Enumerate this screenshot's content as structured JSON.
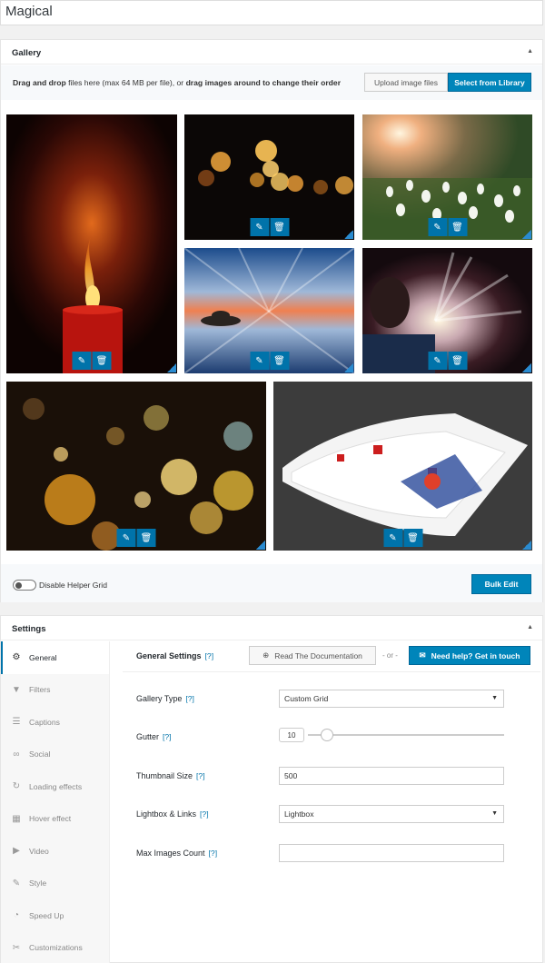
{
  "title": "Magical",
  "gallery": {
    "header": "Gallery",
    "upload": {
      "text_bold1": "Drag and drop",
      "text_mid": " files here (max 64 MB per file), or ",
      "text_bold2": "drag images around to change their order",
      "upload_btn": "Upload image files",
      "library_btn": "Select from Library"
    },
    "images": [
      {
        "name": "candle-flame"
      },
      {
        "name": "bokeh-lights-dark"
      },
      {
        "name": "snowdrop-flowers"
      },
      {
        "name": "island-sunset-reflection"
      },
      {
        "name": "glowing-book"
      },
      {
        "name": "golden-bokeh"
      },
      {
        "name": "playing-cards"
      }
    ],
    "toggle_label": "Disable Helper Grid",
    "bulk_edit": "Bulk Edit"
  },
  "settings": {
    "header": "Settings",
    "tabs": [
      {
        "label": "General",
        "icon": "gear-icon",
        "glyph": "⚙"
      },
      {
        "label": "Filters",
        "icon": "filter-icon",
        "glyph": "▼"
      },
      {
        "label": "Captions",
        "icon": "captions-icon",
        "glyph": "☰"
      },
      {
        "label": "Social",
        "icon": "link-icon",
        "glyph": "∞"
      },
      {
        "label": "Loading effects",
        "icon": "refresh-icon",
        "glyph": "↻"
      },
      {
        "label": "Hover effect",
        "icon": "grid-icon",
        "glyph": "▦"
      },
      {
        "label": "Video",
        "icon": "video-icon",
        "glyph": "▶"
      },
      {
        "label": "Style",
        "icon": "brush-icon",
        "glyph": "✎"
      },
      {
        "label": "Speed Up",
        "icon": "dashboard-icon",
        "glyph": "◔"
      },
      {
        "label": "Customizations",
        "icon": "wrench-icon",
        "glyph": "✂"
      }
    ],
    "general_title": "General Settings",
    "help_mark": "[?]",
    "doc_btn": "Read The Documentation",
    "or_text": "- or -",
    "help_btn": "Need help? Get in touch",
    "fields": {
      "gallery_type": {
        "label": "Gallery Type",
        "value": "Custom Grid"
      },
      "gutter": {
        "label": "Gutter",
        "value": "10"
      },
      "thumbnail_size": {
        "label": "Thumbnail Size",
        "value": "500"
      },
      "lightbox": {
        "label": "Lightbox & Links",
        "value": "Lightbox"
      },
      "max_images": {
        "label": "Max Images Count",
        "value": ""
      }
    }
  }
}
